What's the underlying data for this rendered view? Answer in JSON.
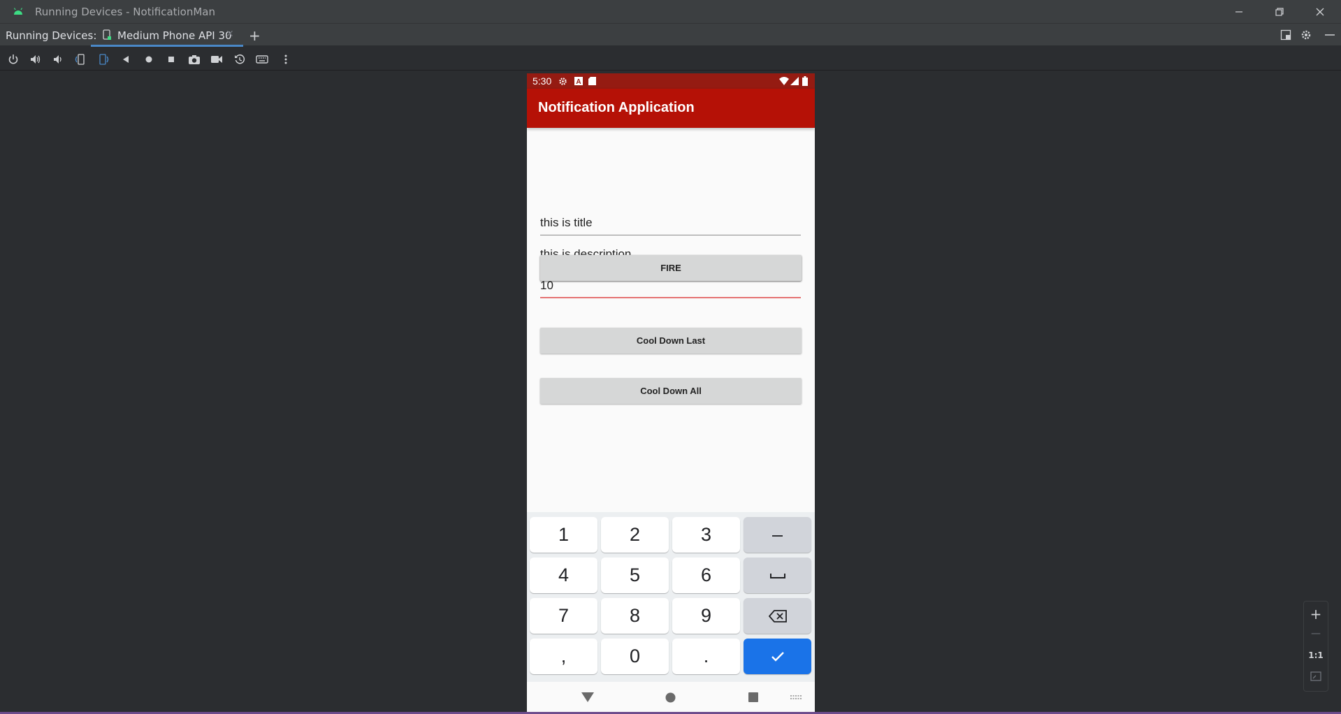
{
  "window": {
    "title": "Running Devices - NotificationMan"
  },
  "tabbar": {
    "label": "Running Devices:",
    "tab_label": "Medium Phone API 30"
  },
  "device": {
    "status_time": "5:30",
    "app_title": "Notification Application",
    "fields": {
      "title_value": "this is title",
      "description_value": "this is description",
      "delay_value": "10"
    },
    "buttons": {
      "fire": "FIRE",
      "cool_down_last": "Cool Down Last",
      "cool_down_all": "Cool Down All"
    },
    "keyboard": {
      "row1": [
        "1",
        "2",
        "3",
        "–"
      ],
      "row2": [
        "4",
        "5",
        "6",
        "␣"
      ],
      "row3": [
        "7",
        "8",
        "9",
        "⌫"
      ],
      "row4": [
        ",",
        "0",
        ".",
        "✓"
      ]
    }
  },
  "zoom": {
    "plus": "+",
    "minus": "—",
    "actual": "1:1"
  },
  "colors": {
    "app_bar": "#b51106",
    "status_bar": "#951b12",
    "enter_key": "#1a73e8",
    "focus_line": "#e57373"
  }
}
